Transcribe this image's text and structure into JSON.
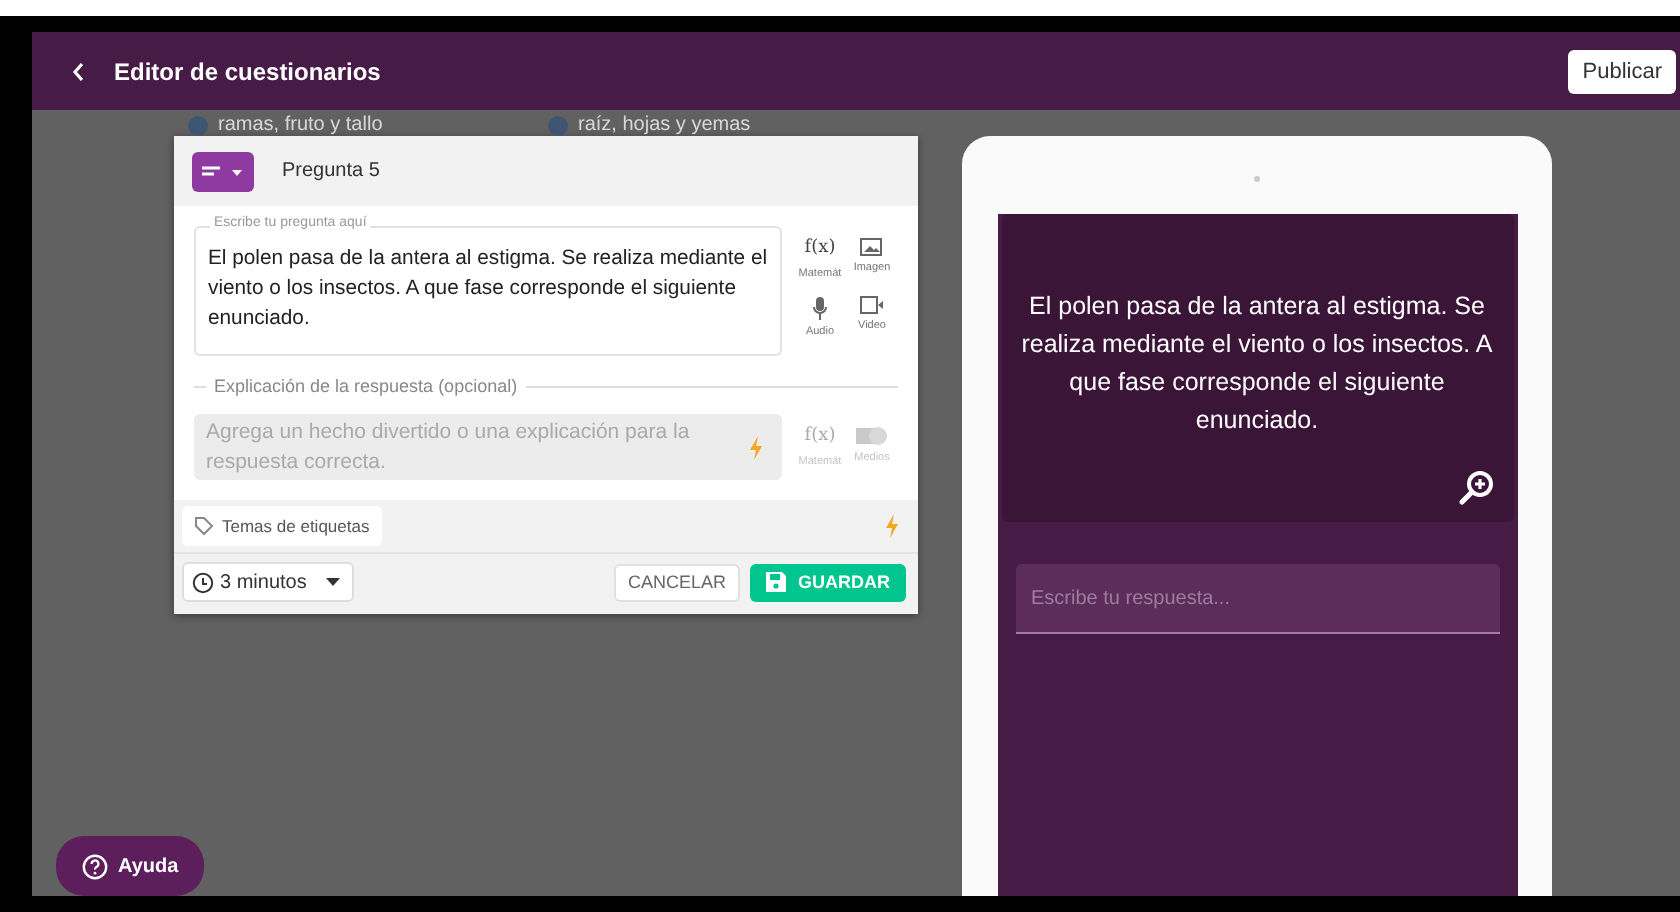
{
  "header": {
    "title": "Editor de cuestionarios",
    "publish_button": "Publicar"
  },
  "background_options": [
    "ramas, fruto y tallo",
    "raíz, hojas y yemas"
  ],
  "editor": {
    "question_label": "Pregunta 5",
    "question_field": {
      "legend": "Escribe tu pregunta aquí",
      "value": "El polen pasa de la antera al estigma. Se realiza mediante el viento o los insectos. A que fase corresponde el siguiente enunciado."
    },
    "question_tools": [
      {
        "kind": "math",
        "glyph": "f(x)",
        "label": "Matemát",
        "disabled": false
      },
      {
        "kind": "image",
        "label": "Imagen",
        "disabled": false
      },
      {
        "kind": "audio",
        "label": "Audio",
        "disabled": false
      },
      {
        "kind": "video",
        "label": "Video",
        "disabled": false
      }
    ],
    "explanation": {
      "legend": "Explicación de la respuesta (opcional)",
      "placeholder": "Agrega un hecho divertido o una explicación para la respuesta correcta.",
      "tools": [
        {
          "kind": "math",
          "glyph": "f(x)",
          "label": "Matemát",
          "disabled": true
        },
        {
          "kind": "media",
          "label": "Medios",
          "disabled": true
        }
      ]
    },
    "tags_button": "Temas de etiquetas",
    "time_select": "3 minutos",
    "cancel_button": "CANCELAR",
    "save_button": "GUARDAR"
  },
  "preview": {
    "question": "El polen pasa de la antera al estigma. Se realiza mediante el viento o los insectos. A que fase corresponde el siguiente enunciado.",
    "answer_placeholder": "Escribe tu respuesta..."
  },
  "help_button": "Ayuda"
}
